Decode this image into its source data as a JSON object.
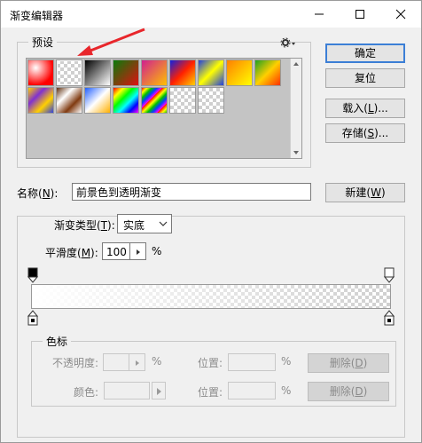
{
  "window": {
    "title": "渐变编辑器"
  },
  "presets": {
    "legend": "预设"
  },
  "buttons": {
    "ok": {
      "pre": "确定",
      "key": "",
      "post": ""
    },
    "reset": {
      "pre": "复位",
      "key": "",
      "post": ""
    },
    "load": {
      "pre": "载入(",
      "key": "L",
      "post": ")..."
    },
    "save": {
      "pre": "存储(",
      "key": "S",
      "post": ")..."
    },
    "new": {
      "pre": "新建(",
      "key": "W",
      "post": ")"
    }
  },
  "name": {
    "label_pre": "名称(",
    "label_key": "N",
    "label_post": "):",
    "value": "前景色到透明渐变"
  },
  "gradient_type": {
    "label_pre": "渐变类型(",
    "label_key": "T",
    "label_post": "):",
    "value": "实底"
  },
  "smoothness": {
    "label_pre": "平滑度(",
    "label_key": "M",
    "label_post": "):",
    "value": "100",
    "unit": "%"
  },
  "stops": {
    "legend": "色标",
    "opacity_label": "不透明度:",
    "opacity_unit": "%",
    "position_label": "位置:",
    "position_unit": "%",
    "delete_pre": "删除(",
    "delete_key": "D",
    "delete_post": ")",
    "color_label": "颜色:"
  },
  "colors": {
    "accent": "#3c7fd6",
    "arrow": "#e8262b"
  }
}
